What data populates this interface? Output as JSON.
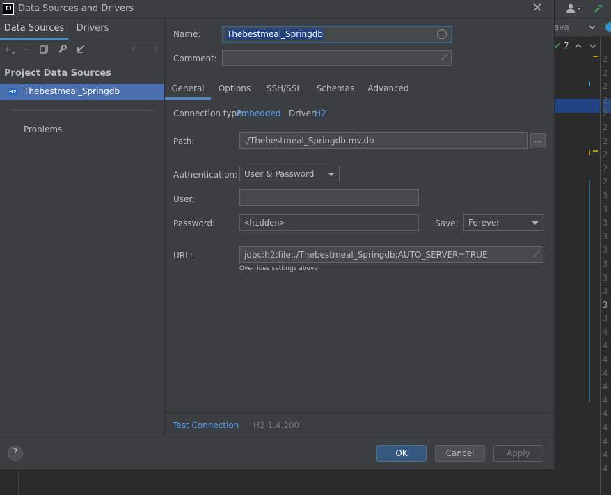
{
  "window": {
    "title": "Data Sources and Drivers",
    "app_icon": "IJ"
  },
  "left_panel": {
    "tabs": [
      {
        "label": "Data Sources"
      },
      {
        "label": "Drivers"
      }
    ],
    "section_header": "Project Data Sources",
    "data_sources": [
      {
        "badge": "H2",
        "label": "Thebestmeal_Springdb"
      }
    ],
    "problems_label": "Problems"
  },
  "form": {
    "name_label": "Name:",
    "name_value": "Thebestmeal_Springdb",
    "comment_label": "Comment:",
    "comment_value": "",
    "tabs": [
      {
        "label": "General"
      },
      {
        "label": "Options"
      },
      {
        "label": "SSH/SSL"
      },
      {
        "label": "Schemas"
      },
      {
        "label": "Advanced"
      }
    ],
    "connection_type_label": "Connection type:",
    "connection_type_value": "Embedded",
    "driver_label": "Driver:",
    "driver_value": "H2",
    "path_label": "Path:",
    "path_value": "./Thebestmeal_Springdb.mv.db",
    "browse_label": "...",
    "auth_label": "Authentication:",
    "auth_value": "User & Password",
    "user_label": "User:",
    "user_value": "",
    "password_label": "Password:",
    "password_placeholder": "<hidden>",
    "save_label": "Save:",
    "save_value": "Forever",
    "url_label": "URL:",
    "url_value": "jdbc:h2:file:./Thebestmeal_Springdb;AUTO_SERVER=TRUE",
    "url_hint": "Overrides settings above",
    "test_connection": "Test Connection",
    "driver_version": "H2 1.4.200"
  },
  "footer": {
    "help": "?",
    "ok": "OK",
    "cancel": "Cancel",
    "apply": "Apply"
  },
  "ide_background": {
    "tab_fragment": "ava",
    "inspection_count": "7",
    "line_number_digits": [
      "2",
      "2",
      "2",
      "2",
      "2",
      "2",
      "2",
      "2",
      "2",
      "2",
      "3",
      "3",
      "3",
      "3",
      "3",
      "3",
      "3",
      "3",
      "3",
      "3",
      "4",
      "4",
      "4",
      "4",
      "4",
      "4",
      "4",
      "4",
      "4",
      "4",
      "4"
    ]
  },
  "colors": {
    "accent": "#4a88c7",
    "selection": "#4b6eaf",
    "link": "#589df6",
    "primary_button": "#365880"
  }
}
